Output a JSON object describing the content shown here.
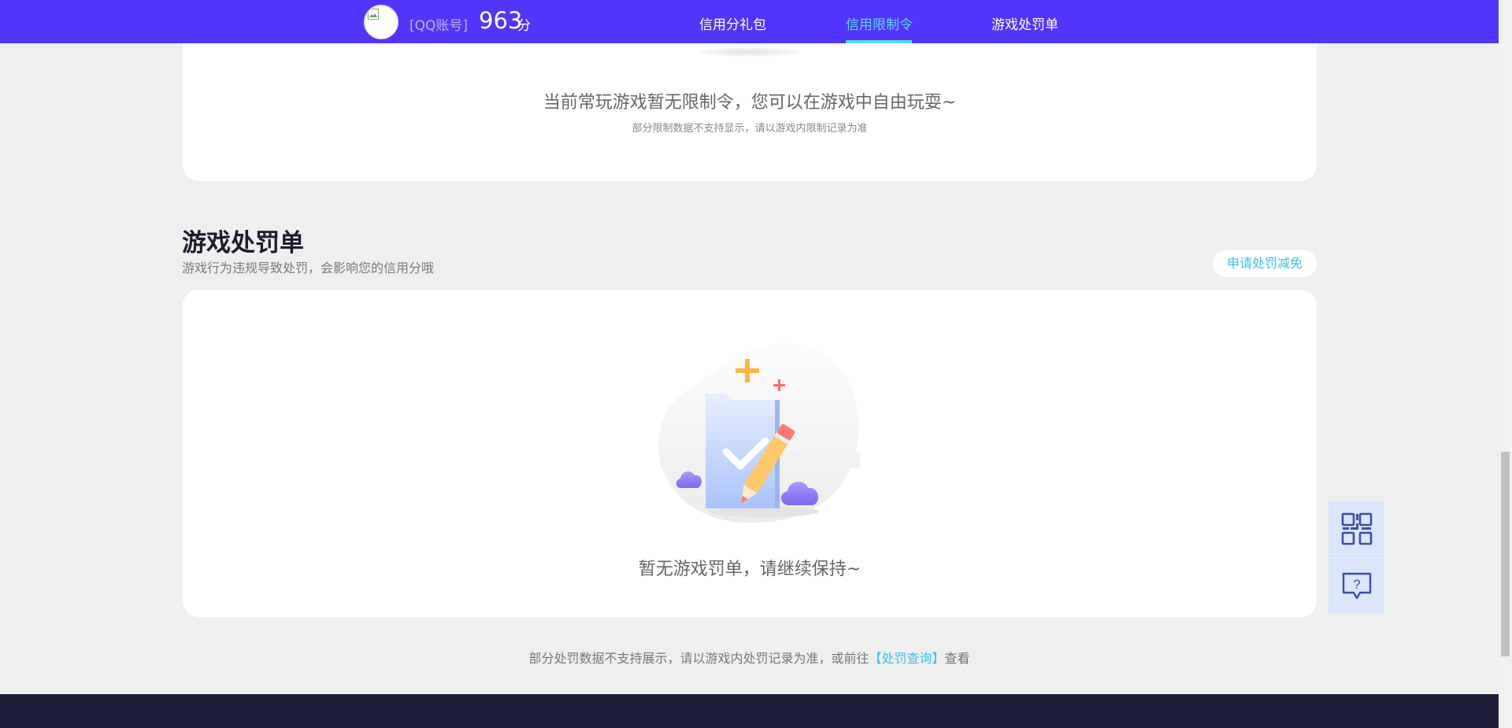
{
  "header": {
    "account_label": "[QQ账号]",
    "score": "963",
    "score_unit": "分",
    "nav": [
      {
        "label": "信用分礼包",
        "active": false
      },
      {
        "label": "信用限制令",
        "active": true
      },
      {
        "label": "游戏处罚单",
        "active": false
      }
    ]
  },
  "restriction": {
    "main_text": "当前常玩游戏暂无限制令，您可以在游戏中自由玩耍~",
    "sub_text": "部分限制数据不支持显示，请以游戏内限制记录为准"
  },
  "penalty": {
    "title": "游戏处罚单",
    "subtitle": "游戏行为违规导致处罚，会影响您的信用分哦",
    "appeal_button": "申请处罚减免",
    "empty_text": "暂无游戏罚单，请继续保持~",
    "note_prefix": "部分处罚数据不支持展示，请以游戏内处罚记录为准，或前往",
    "note_link": "【处罚查询】",
    "note_suffix": "查看"
  },
  "side_tools": {
    "qr_icon": "qr-code-icon",
    "help_icon": "help-chat-icon"
  },
  "colors": {
    "nav_bg": "#5235fb",
    "accent": "#5ad9ff",
    "link": "#3cc0e8",
    "page_bg": "#efefef",
    "footer_bg": "#1e1f3b"
  }
}
